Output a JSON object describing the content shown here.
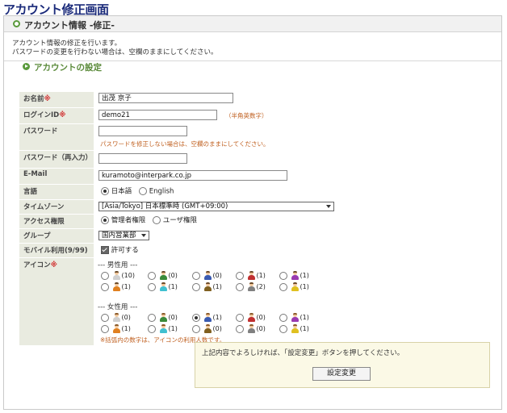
{
  "page_title": "アカウント修正画面",
  "section_title": "アカウント情報 -修正-",
  "intro": [
    "アカウント情報の修正を行います。",
    "パスワードの変更を行わない場合は、空欄のままにしてください。"
  ],
  "settings_title": "アカウントの設定",
  "required_mark": "※",
  "fields": {
    "name": {
      "label": "お名前",
      "value": "出茂 京子"
    },
    "login": {
      "label": "ログインID",
      "value": "demo21",
      "hint": "（半角英数字）"
    },
    "password": {
      "label": "パスワード",
      "value": "",
      "hint": "パスワードを修正しない場合は、空欄のままにしてください。"
    },
    "password_confirm": {
      "label": "パスワード（再入力）",
      "value": ""
    },
    "email": {
      "label": "E-Mail",
      "value": "kuramoto@interpark.co.jp"
    },
    "language": {
      "label": "言語",
      "options": [
        "日本語",
        "English"
      ],
      "selected": "日本語"
    },
    "timezone": {
      "label": "タイムゾーン",
      "value": "[Asia/Tokyo] 日本標準時 (GMT+09:00)"
    },
    "access": {
      "label": "アクセス権限",
      "options": [
        "管理者権限",
        "ユーザ権限"
      ],
      "selected": "管理者権限"
    },
    "group": {
      "label": "グループ",
      "value": "国内営業部"
    },
    "mobile": {
      "label": "モバイル利用(9/99)",
      "checkbox_label": "許可する",
      "checked": true
    },
    "icon": {
      "label": "アイコン",
      "male_label": "--- 男性用 ---",
      "female_label": "--- 女性用 ---",
      "male_row1": [
        "(10)",
        "(0)",
        "(0)",
        "(1)",
        "(1)"
      ],
      "male_row2": [
        "(1)",
        "(1)",
        "(1)",
        "(2)",
        "(1)"
      ],
      "female_row1": [
        "(0)",
        "(0)",
        "(1)",
        "(0)",
        "(1)"
      ],
      "female_row2": [
        "(1)",
        "(1)",
        "(0)",
        "(0)",
        "(1)"
      ],
      "selected": "female_row1_2",
      "note": "※括弧内の数字は、アイコンの利用人数です。"
    }
  },
  "confirm": {
    "text": "上記内容でよろしければ、「設定変更」ボタンを押してください。",
    "button": "設定変更"
  },
  "colors": {
    "accent": "#5a9a3c",
    "title": "#1a2a7a",
    "required": "#d03030",
    "hint": "#c06020",
    "label_bg": "#e9ebe0"
  }
}
